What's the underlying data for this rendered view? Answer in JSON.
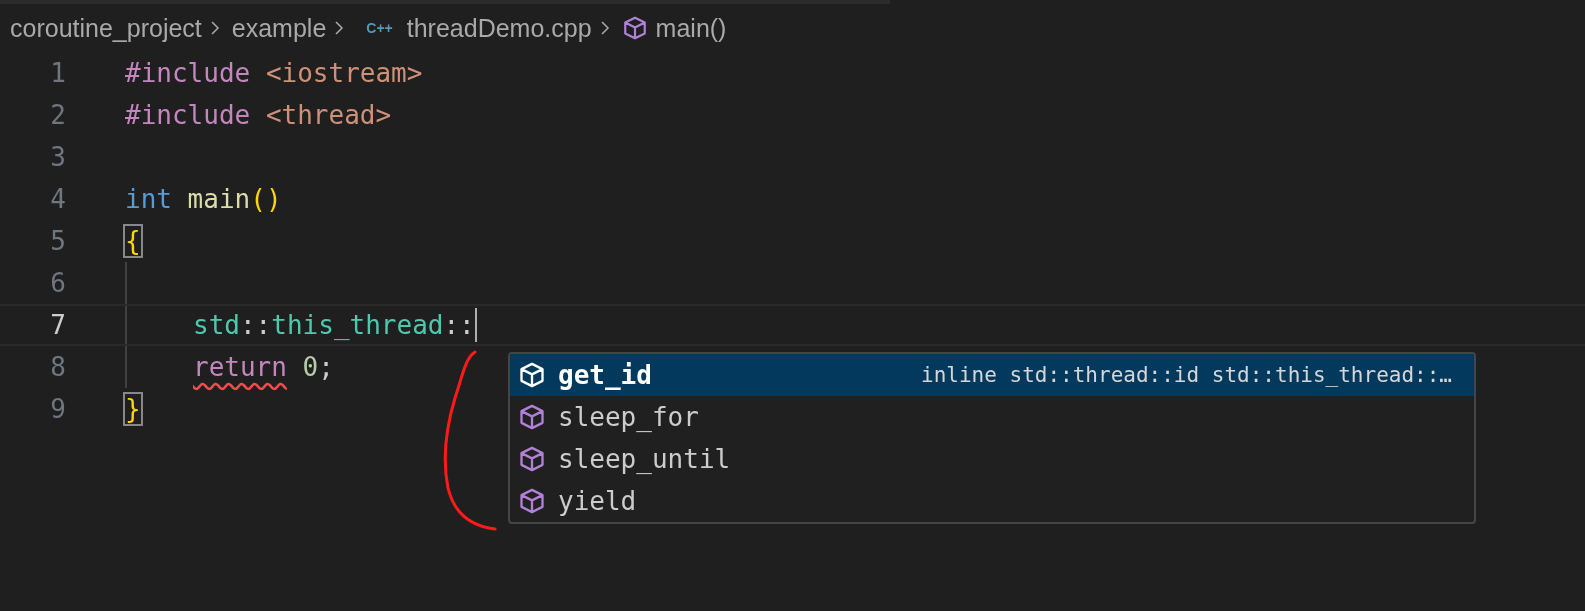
{
  "breadcrumb": [
    {
      "kind": "folder",
      "label": "coroutine_project"
    },
    {
      "kind": "folder",
      "label": "example"
    },
    {
      "kind": "file",
      "label": "threadDemo.cpp",
      "icon_text": "C++"
    },
    {
      "kind": "symbol",
      "label": "main()"
    }
  ],
  "editor": {
    "lines": [
      {
        "number": "1",
        "current": false,
        "in_block": false,
        "tokens": [
          {
            "kind": "preprocessor",
            "text": "#include"
          },
          {
            "kind": "string",
            "text": " <iostream>"
          }
        ]
      },
      {
        "number": "2",
        "current": false,
        "in_block": false,
        "tokens": [
          {
            "kind": "preprocessor",
            "text": "#include"
          },
          {
            "kind": "string",
            "text": " <thread>"
          }
        ]
      },
      {
        "number": "3",
        "current": false,
        "in_block": false
      },
      {
        "number": "4",
        "current": false,
        "in_block": false,
        "tokens": [
          {
            "kind": "type",
            "text": "int"
          },
          {
            "kind": "function",
            "text": " main"
          },
          {
            "kind": "bracket",
            "text": "()"
          }
        ]
      },
      {
        "number": "5",
        "current": false,
        "in_block": false,
        "tokens": [
          {
            "kind": "bracket",
            "text": "{",
            "matched": true
          }
        ]
      },
      {
        "number": "6",
        "current": false,
        "in_block": true
      },
      {
        "number": "7",
        "current": true,
        "in_block": true,
        "tokens": [
          {
            "kind": "namespace",
            "text": "std"
          },
          {
            "kind": "plain",
            "text": "::"
          },
          {
            "kind": "namespace",
            "text": "this_thread"
          },
          {
            "kind": "plain",
            "text": "::"
          }
        ]
      },
      {
        "number": "8",
        "current": false,
        "in_block": true,
        "tokens": [
          {
            "kind": "keyword",
            "text": "return",
            "error": true
          },
          {
            "kind": "number",
            "text": " 0"
          },
          {
            "kind": "plain",
            "text": ";"
          }
        ]
      },
      {
        "number": "9",
        "current": false,
        "in_block": false,
        "tokens": [
          {
            "kind": "bracket",
            "text": "}",
            "matched": true
          }
        ]
      }
    ]
  },
  "suggestions": [
    {
      "label": "get_id",
      "selected": true,
      "detail": "inline std::thread::id std::this_thread::…"
    },
    {
      "label": "sleep_for",
      "selected": false
    },
    {
      "label": "sleep_until",
      "selected": false
    },
    {
      "label": "yield",
      "selected": false
    }
  ],
  "annotation": {
    "kind": "curve"
  }
}
